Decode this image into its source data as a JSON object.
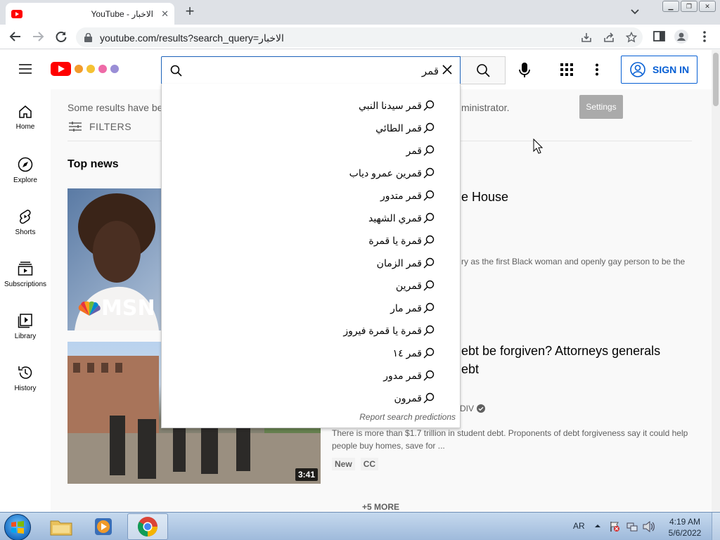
{
  "browser": {
    "tab_title": "YouTube - الاخبار",
    "url": "youtube.com/results?search_query=الاخبار"
  },
  "masthead": {
    "search_query": "قمر",
    "signin_label": "SIGN IN"
  },
  "guide": {
    "items": [
      {
        "label": "Home",
        "icon": "home-icon"
      },
      {
        "label": "Explore",
        "icon": "compass-icon"
      },
      {
        "label": "Shorts",
        "icon": "shorts-icon"
      },
      {
        "label": "Subscriptions",
        "icon": "subscriptions-icon"
      },
      {
        "label": "Library",
        "icon": "library-icon"
      },
      {
        "label": "History",
        "icon": "history-icon"
      }
    ]
  },
  "main": {
    "notice_start": "Some results have be",
    "notice_end": "ministrator.",
    "settings_label": "Settings",
    "filters_label": "FILTERS",
    "section_title": "Top news",
    "video1": {
      "title_fragment": "e House",
      "desc_fragment": "ry as the first Black woman and openly gay person to be the",
      "thumb_brand": "MSN"
    },
    "video2": {
      "title_line1": "ebt be forgiven? Attorneys generals",
      "title_line2": "ebt",
      "channel_fragment": "DIV",
      "desc": "There is more than $1.7 trillion in student debt. Proponents of debt forgiveness say it could help people buy homes, save for ...",
      "duration": "3:41",
      "badges": [
        "New",
        "CC"
      ]
    },
    "more_label": "+5 MORE"
  },
  "suggestions": {
    "items": [
      "قمر سيدنا النبي",
      "قمر الطائي",
      "قمر",
      "قمرين عمرو دياب",
      "قمر متدور",
      "قمري الشهيد",
      "قمرة يا قمرة",
      "قمر الزمان",
      "قمرين",
      "قمر مار",
      "قمرة يا قمرة فيروز",
      "قمر ١٤",
      "قمر مدور",
      "قمرون"
    ],
    "report_label": "Report search predictions"
  },
  "taskbar": {
    "language": "AR",
    "time": "4:19 AM",
    "date": "5/6/2022"
  }
}
